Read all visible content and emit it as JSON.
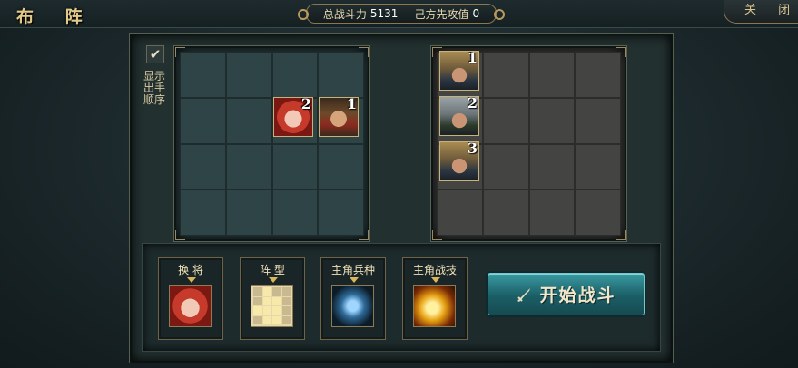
{
  "header": {
    "title": "布 阵",
    "power_label": "总战斗力",
    "power_value": "5131",
    "first_label": "己方先攻值",
    "first_value": "0",
    "close_label": "关 闭"
  },
  "options": {
    "show_order_checked": true,
    "show_order_label": "显示出手顺序"
  },
  "my_formation": {
    "units": [
      {
        "name": "red-haired-heroine",
        "order": "2",
        "row": 2,
        "col": 3
      },
      {
        "name": "armored-general",
        "order": "1",
        "row": 2,
        "col": 4
      }
    ]
  },
  "enemy_formation": {
    "units": [
      {
        "name": "helmeted-soldier",
        "order": "1",
        "row": 1,
        "col": 1
      },
      {
        "name": "steel-helmet-soldier",
        "order": "2",
        "row": 2,
        "col": 1
      },
      {
        "name": "helmeted-soldier",
        "order": "3",
        "row": 3,
        "col": 1
      }
    ]
  },
  "bottom": {
    "swap_general": "换 将",
    "formation_type": "阵 型",
    "lead_troop": "主角兵种",
    "lead_skill": "主角战技",
    "start_battle": "开始战斗"
  },
  "icons": {
    "check": "check-icon",
    "sword": "sword-icon",
    "troop": "troop-emblem-icon",
    "skill": "skill-flame-icon"
  },
  "colors": {
    "accent_gold": "#d9c48f",
    "start_button": "#1b5e66"
  }
}
